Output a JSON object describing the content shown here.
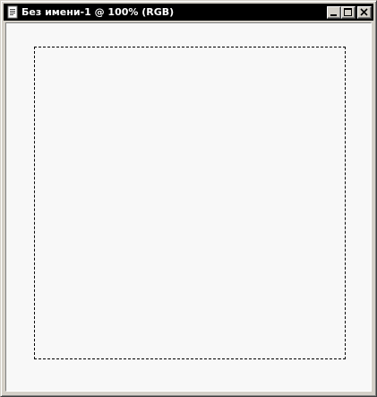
{
  "window": {
    "title": "Без имени-1 @ 100% (RGB)",
    "icon": "document-icon",
    "buttons": {
      "minimize": "minimize-icon",
      "maximize": "maximize-icon",
      "close": "close-icon"
    }
  },
  "canvas": {
    "background_color": "#f8f8f8",
    "selection": "marquee-selection"
  },
  "colors": {
    "titlebar": "#000000",
    "title_text": "#ffffff",
    "frame": "#d4d0c8"
  }
}
